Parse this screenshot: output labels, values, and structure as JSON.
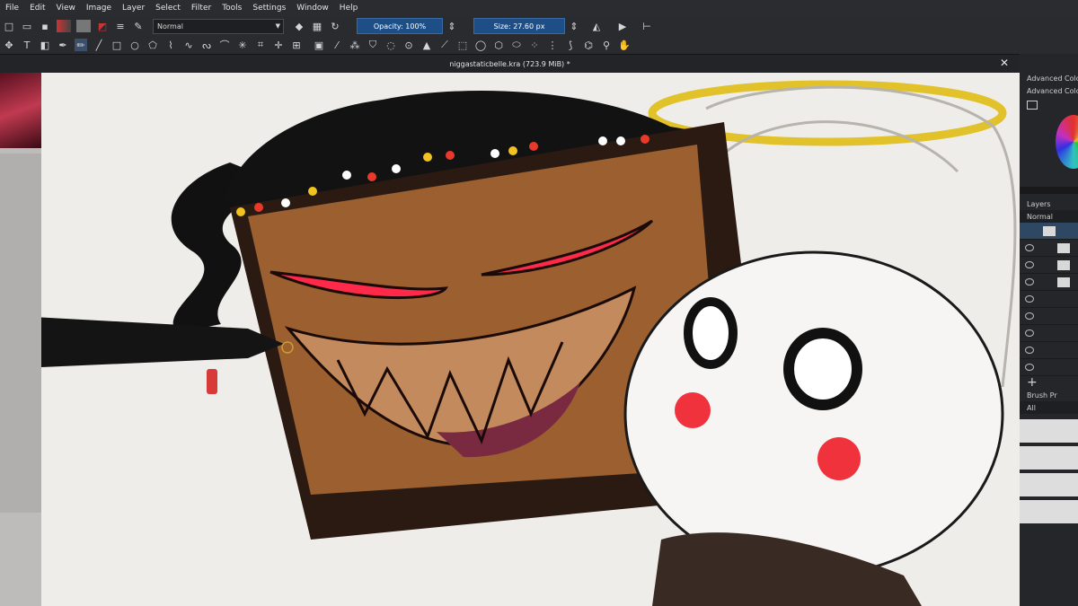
{
  "menu": [
    "File",
    "Edit",
    "View",
    "Image",
    "Layer",
    "Select",
    "Filter",
    "Tools",
    "Settings",
    "Window",
    "Help"
  ],
  "toolbar": {
    "blend_mode": "Normal",
    "opacity_label": "Opacity: 100%",
    "size_label": "Size: 27.60 px"
  },
  "document": {
    "tab_title": "niggastaticbelle.kra (723.9 MiB) *",
    "close_glyph": "✕"
  },
  "dock": {
    "advanced_color_title": "Advanced Colo",
    "advanced_color_sub": "Advanced Colo",
    "layers_title": "Layers",
    "layers_blend": "Normal",
    "brush_title": "Brush Pr",
    "brush_filter": "All",
    "add_glyph": "+"
  },
  "colors": {
    "accent": "#1d4f86",
    "panel_bg": "#25262a",
    "canvas_bg": "#efedea",
    "character_skin": "#9b5f30",
    "eye_red": "#ff2a4a",
    "halo": "#e2c22a"
  }
}
